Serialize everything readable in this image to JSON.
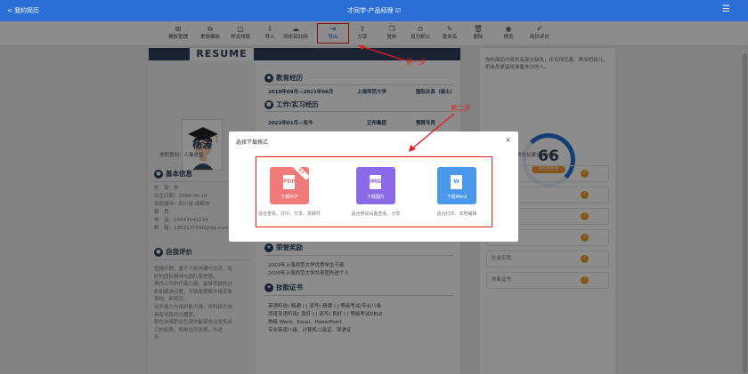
{
  "topbar": {
    "back": "< 我的简历",
    "title": "才同学-产品经理 ☑",
    "menu": "☰"
  },
  "toolbar": {
    "items": [
      {
        "label": "模板管理",
        "icon": "⊞"
      },
      {
        "label": "更换模板",
        "icon": "⧉"
      },
      {
        "label": "样式排版",
        "icon": "◫"
      },
      {
        "label": "导入",
        "icon": "⇩"
      },
      {
        "label": "同步就业网",
        "icon": "☁"
      },
      {
        "label": "导出",
        "icon": "⇥"
      },
      {
        "label": "分享",
        "icon": "⇪"
      },
      {
        "label": "复制",
        "icon": "❐"
      },
      {
        "label": "设为默认",
        "icon": "⊙"
      },
      {
        "label": "重命名",
        "icon": "✎"
      },
      {
        "label": "删除",
        "icon": "🗑"
      },
      {
        "label": "预览",
        "icon": "◉"
      },
      {
        "label": "简历评价",
        "icon": "✐"
      }
    ]
  },
  "resume": {
    "header": "RESUME",
    "name": "杨涛",
    "intent": "求职意向：人事总监",
    "basic_title": "基本信息",
    "basic": [
      "性　别：男",
      "出生日期：1994-09-14",
      "现居城市：四川省-成都市",
      "籍　贯：",
      "电　话：15047642234",
      "邮　箱：1353137596@qq.com"
    ],
    "self_title": "自我评价",
    "self": [
      "性格开朗，善于人际沟通与交流，较",
      "好的团队精神与团队荣誉感。",
      "责任心与执行能力强，能够系统的分",
      "析和解决问题，可快速理解并接受新",
      "事物、新观念。",
      "动手能力与组织能力强，对科研方向",
      "具有浓厚的兴趣度。",
      "愿在未来职业生涯中能够充分发挥自",
      "己的优势，和单位同发展，共进",
      "步。"
    ],
    "edu_title": "教育经历",
    "edu": {
      "period": "2018年09月—2021年06月",
      "school": "上海师范大学",
      "major": "国际关系（硕士）"
    },
    "work_title": "工作/实习经历",
    "work": {
      "period": "2022年01月—至今",
      "company": "正邦集团",
      "role": "预算专员"
    },
    "honor_title": "荣誉奖励",
    "honors": [
      "2019年上海师范大学优秀学生干部",
      "2020年上海师范大学共青团先进个人"
    ],
    "skill_title": "技能证书",
    "skills": [
      "英语听说( 精通 ) | 读写( 精通 ) | 等级考试/专业八级",
      "西班牙语听说( 良好 ) | 读写( 良好 ) | 等级考试DELE",
      "熟练 Word、Excel、PowerPoint",
      "专业英语八级、计算机二级证、驾驶证"
    ]
  },
  "side": {
    "hint": "你的简历内容尚有部分缺失，还有待完善，再加把劲儿，机会总是留给准备充分的人。",
    "score": "66",
    "score_tag": "简历待完善",
    "diagnose": "共诊断优化建议:共6条",
    "items": [
      {
        "label": "",
        "count": "!"
      },
      {
        "label": "",
        "count": "!"
      },
      {
        "label": "",
        "count": "!"
      },
      {
        "label": "",
        "count": "!"
      },
      {
        "label": "社会实践",
        "count": "!"
      },
      {
        "label": "技能证书",
        "count": "!"
      }
    ]
  },
  "modal": {
    "title": "选择下载格式",
    "close": "×",
    "options": [
      {
        "label": "下载PDF",
        "icon": "PDF",
        "desc": "适合查看、打印、分享、发邮件",
        "color": "#f07a7a",
        "ribbon": "推荐"
      },
      {
        "label": "下载图片",
        "icon": "IMG",
        "desc": "适合移动设备查看、分享",
        "color": "#8b6ae8"
      },
      {
        "label": "下载Word",
        "icon": "W",
        "desc": "适合打印、本地编辑",
        "color": "#4a98ec"
      }
    ]
  },
  "annotations": {
    "step1": "第一步",
    "step2": "第二步"
  }
}
